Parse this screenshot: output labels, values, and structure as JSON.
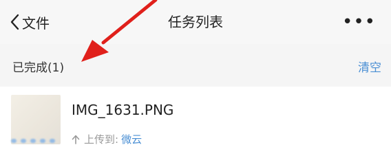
{
  "navbar": {
    "back_label": "文件",
    "title": "任务列表",
    "more_label": "•••"
  },
  "section": {
    "title": "已完成(1)",
    "clear_label": "清空"
  },
  "task": {
    "file_name": "IMG_1631.PNG",
    "status_prefix": "上传到:",
    "destination": "微云"
  },
  "colors": {
    "accent": "#4a8fd4",
    "annotation_arrow": "#e0201b"
  },
  "icons": {
    "back": "chevron-left-icon",
    "more": "more-horizontal-icon",
    "upload": "arrow-up-icon",
    "annotation": "red-arrow-annotation"
  }
}
